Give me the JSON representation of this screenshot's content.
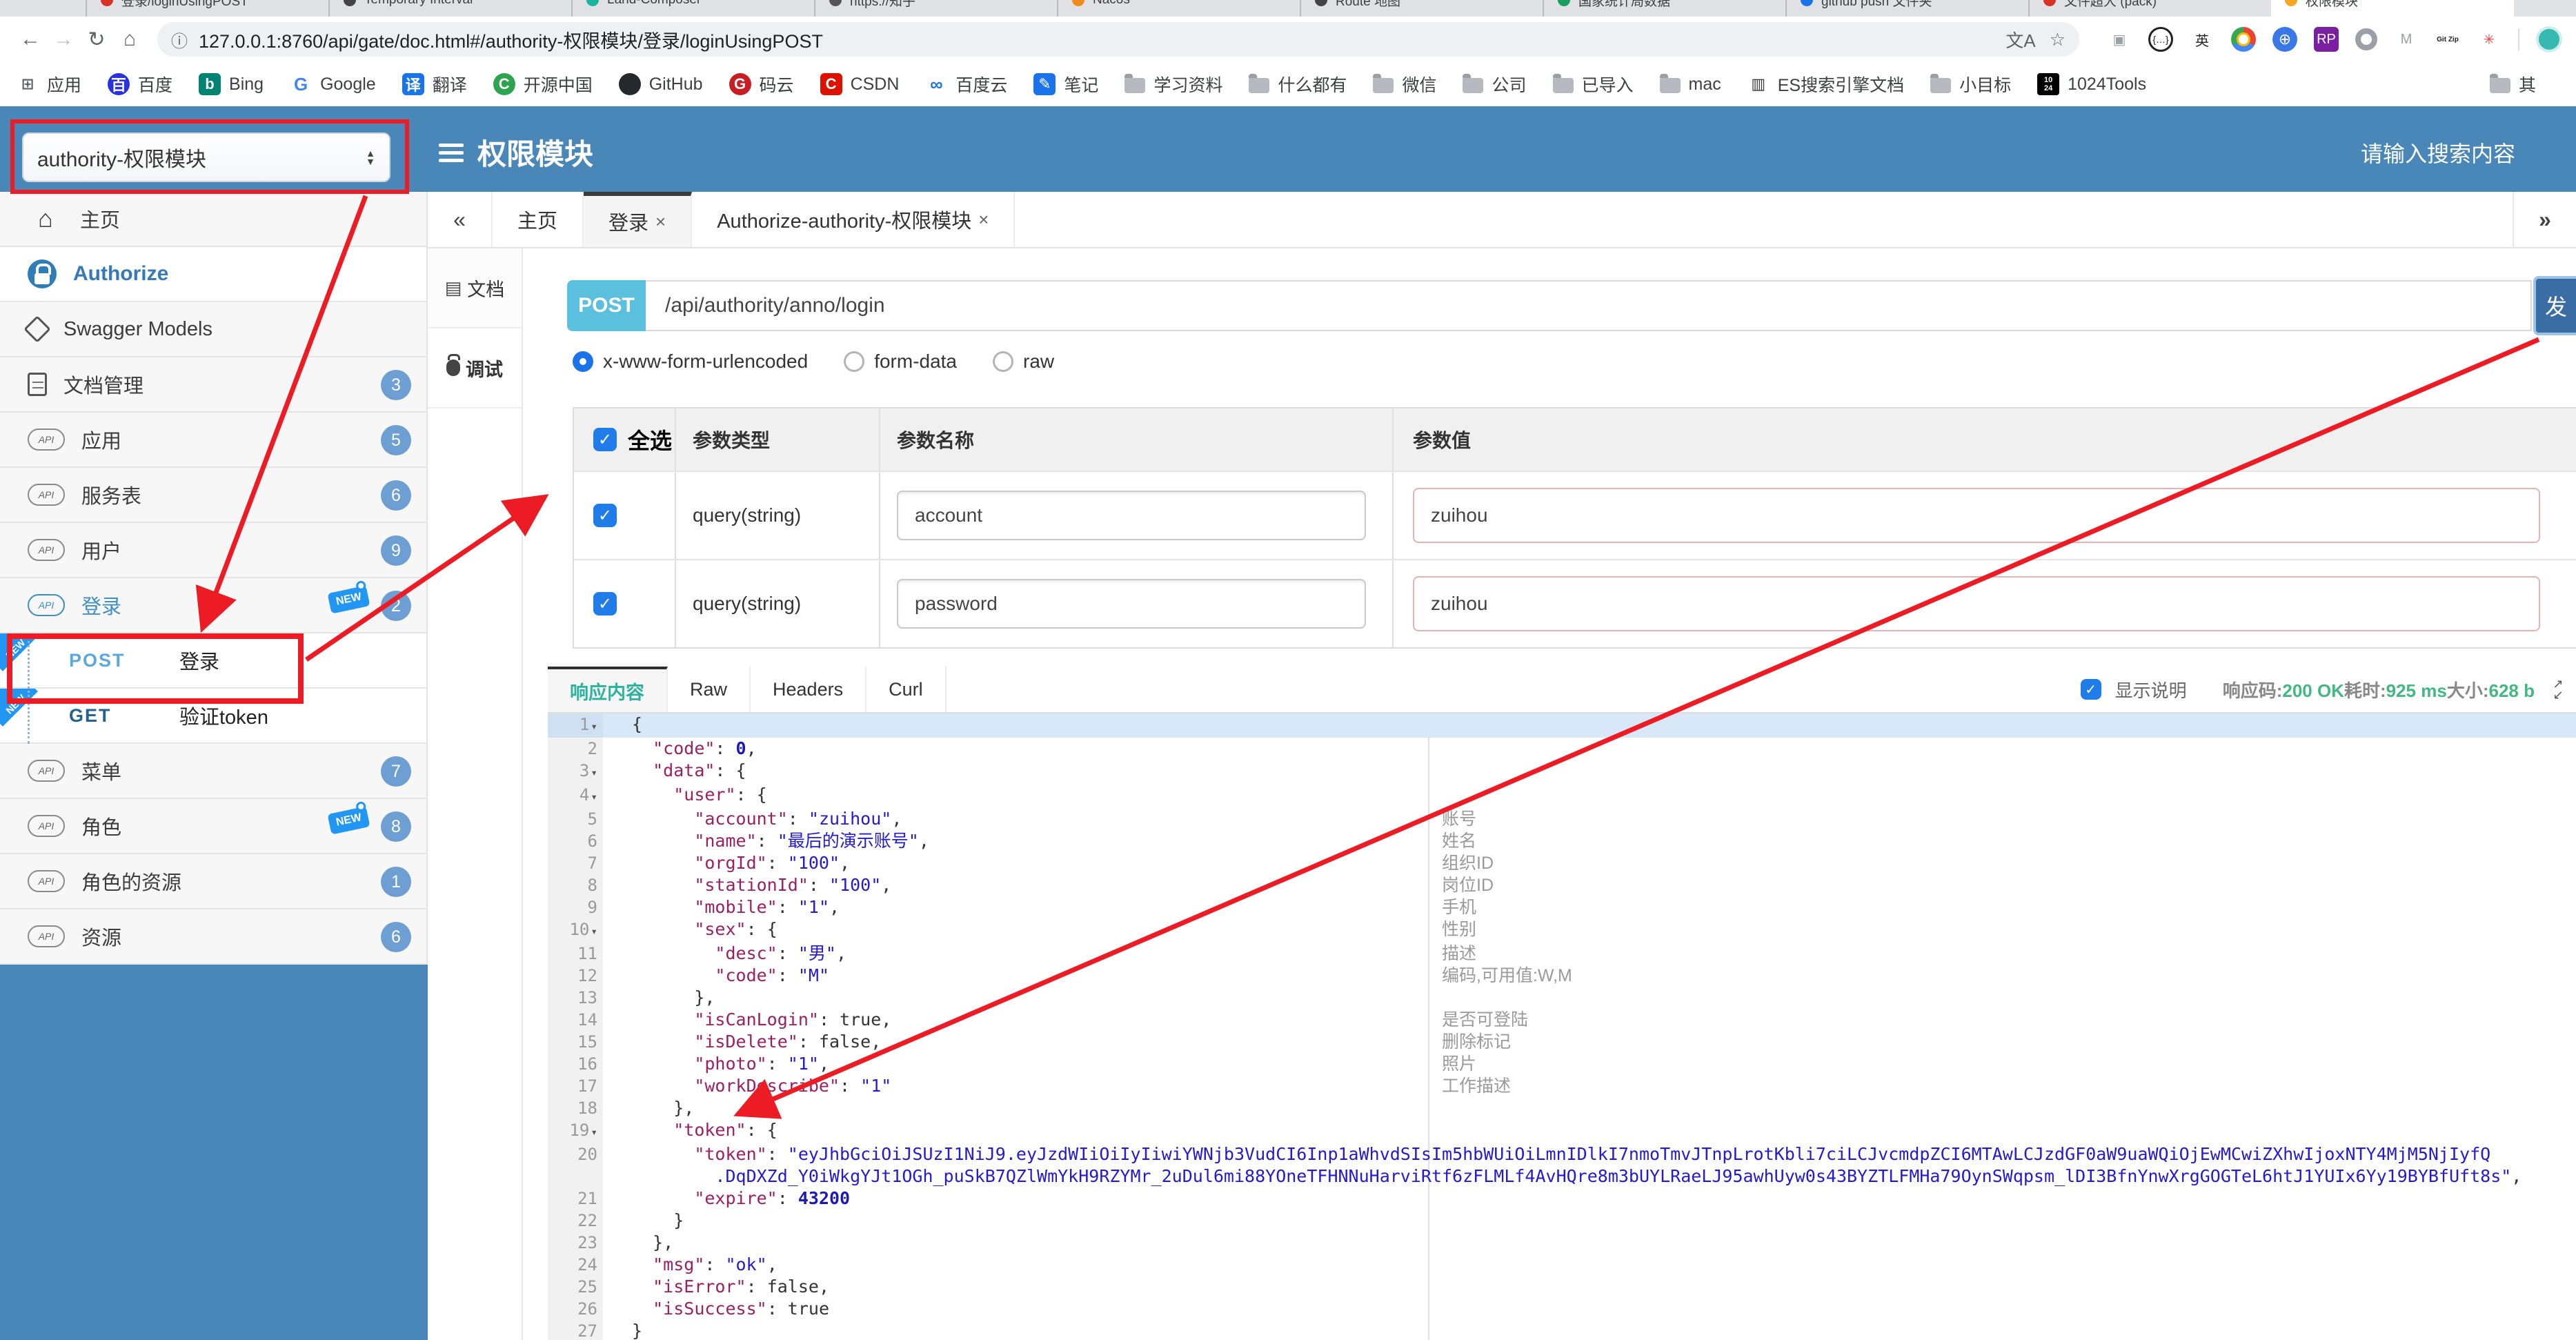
{
  "browser": {
    "tab_strip": [
      {
        "t": "登录/loginUsingPOST",
        "c": "#d93025"
      },
      {
        "t": "Temporary Interval",
        "c": "#444444"
      },
      {
        "t": "Land-Composer",
        "c": "#18b5a0"
      },
      {
        "t": "https://知乎",
        "c": "#555555"
      },
      {
        "t": "Nacos",
        "c": "#f08c1a"
      },
      {
        "t": "Route 地图",
        "c": "#444444"
      },
      {
        "t": "国家统计局数据",
        "c": "#17a05d"
      },
      {
        "t": "github push 文件夹",
        "c": "#1a73e8"
      },
      {
        "t": "文件超大 (pack)",
        "c": "#d93025"
      },
      {
        "t": "权限模块",
        "c": "#f5a623",
        "cls": "active"
      }
    ],
    "nav": {
      "back": "←",
      "forward": "→",
      "reload": "↻",
      "home": "⌂"
    },
    "url": {
      "info_icon": "ⓘ",
      "text": "127.0.0.1:8760/api/gate/doc.html#/authority-权限模块/登录/loginUsingPOST",
      "translate_icon": "文A",
      "star_icon": "☆"
    },
    "extensions": [
      {
        "g": "▣",
        "fg": "#9aa0a6"
      },
      {
        "g": "{…}",
        "fg": "#202124",
        "cls": "ring"
      },
      {
        "g": "英",
        "fg": "#202124"
      },
      {
        "g": "",
        "cls": "chrome"
      },
      {
        "g": "",
        "cls": "globe"
      },
      {
        "g": "RP",
        "bg": "#7b1fa2",
        "fg": "#ffffff"
      },
      {
        "g": "",
        "fg": "#9aa0a6",
        "cls": "ring2"
      },
      {
        "g": "M",
        "fg": "#9aa0a6"
      },
      {
        "g": "Git Zip",
        "fg": "#202124",
        "cls": "tiny"
      },
      {
        "g": "✳",
        "fg": "#e8453c"
      }
    ],
    "bookmarks": [
      {
        "label": "应用",
        "glyph": "⊞",
        "fg": "#5f6368"
      },
      {
        "label": "百度",
        "glyph": "百",
        "bg": "#2932e1",
        "fg": "#ffffff",
        "cls": "round"
      },
      {
        "label": "Bing",
        "glyph": "b",
        "bg": "#008373",
        "fg": "#ffffff"
      },
      {
        "label": "Google",
        "glyph": "G",
        "fg": "#4285f4",
        "cls": "bold"
      },
      {
        "label": "翻译",
        "glyph": "译",
        "bg": "#1a73e8",
        "fg": "#ffffff"
      },
      {
        "label": "开源中国",
        "glyph": "C",
        "bg": "#2ea44f",
        "fg": "#ffffff",
        "cls": "round"
      },
      {
        "label": "GitHub",
        "glyph": "",
        "bg": "#24292e",
        "fg": "#ffffff",
        "cls": "round"
      },
      {
        "label": "码云",
        "glyph": "G",
        "bg": "#c71d23",
        "fg": "#ffffff",
        "cls": "round"
      },
      {
        "label": "CSDN",
        "glyph": "C",
        "bg": "#dd1100",
        "fg": "#ffffff"
      },
      {
        "label": "百度云",
        "glyph": "∞",
        "fg": "#1a73e8",
        "cls": "bold"
      },
      {
        "label": "笔记",
        "glyph": "✎",
        "bg": "#1a73e8",
        "fg": "#ffffff"
      },
      {
        "label": "学习资料",
        "cls": "folder"
      },
      {
        "label": "什么都有",
        "cls": "folder"
      },
      {
        "label": "微信",
        "cls": "folder"
      },
      {
        "label": "公司",
        "cls": "folder"
      },
      {
        "label": "已导入",
        "cls": "folder"
      },
      {
        "label": "mac",
        "cls": "folder"
      },
      {
        "label": "ES搜索引擎文档",
        "glyph": "▥",
        "fg": "#333333"
      },
      {
        "label": "小目标",
        "cls": "folder"
      },
      {
        "label": "1024Tools",
        "glyph": "10\n24",
        "bg": "#000000",
        "fg": "#ffffff",
        "cls": "tiny"
      }
    ],
    "overflow_bookmark": "其"
  },
  "header": {
    "module_select_value": "authority-权限模块",
    "title": "权限模块",
    "search_placeholder": "请输入搜索内容",
    "accent": "#4a87b9"
  },
  "sidebar": {
    "items": [
      {
        "icls": "ic-home",
        "iglyph": "⌂",
        "label": "主页"
      },
      {
        "icls": "ic-lock",
        "label": "Authorize",
        "lcls": "lbl-auth",
        "cls": "white"
      },
      {
        "icls": "ic-hex",
        "label": "Swagger Models"
      },
      {
        "icls": "ic-page",
        "label": "文档管理",
        "badge": "3"
      },
      {
        "icls": "ic-api",
        "label": "应用",
        "badge": "5"
      },
      {
        "icls": "ic-api",
        "label": "服务表",
        "badge": "6"
      },
      {
        "icls": "ic-api",
        "label": "用户",
        "badge": "9"
      },
      {
        "icls": "ic-api blue",
        "label": "登录",
        "lcls": "lbl-blue",
        "badge": "2",
        "newsign": "NEW"
      },
      {
        "cls": "sub",
        "icls": "none",
        "m": "POST",
        "mcls": "m-post",
        "label": "登录",
        "ribbon": "NEW"
      },
      {
        "cls": "sub",
        "icls": "none",
        "m": "GET",
        "mcls": "m-get",
        "label": "验证token",
        "ribbon": "NEW"
      },
      {
        "icls": "ic-api",
        "label": "菜单",
        "badge": "7"
      },
      {
        "icls": "ic-api",
        "label": "角色",
        "badge": "8",
        "newsign": "NEW"
      },
      {
        "icls": "ic-api",
        "label": "角色的资源",
        "badge": "1"
      },
      {
        "icls": "ic-api",
        "label": "资源",
        "badge": "6"
      }
    ]
  },
  "content": {
    "collapse_icon": "«",
    "more_icon": "»",
    "tabs": [
      {
        "label": "主页"
      },
      {
        "label": "登录",
        "close": "×",
        "cls": "active"
      },
      {
        "label": "Authorize-authority-权限模块",
        "close": "×"
      }
    ],
    "subnav": [
      {
        "label": "文档",
        "icls": "ic-doc"
      },
      {
        "label": "调试",
        "icls": "ic-bug",
        "cls": "active"
      }
    ]
  },
  "request": {
    "method": "POST",
    "url": "/api/authority/anno/login",
    "send_label": "发",
    "body_types": [
      {
        "label": "x-www-form-urlencoded",
        "cls": "sel"
      },
      {
        "label": "form-data"
      },
      {
        "label": "raw"
      }
    ],
    "table": {
      "h_select": "全选",
      "h_type": "参数类型",
      "h_name": "参数名称",
      "h_value": "参数值",
      "rows": [
        {
          "type": "query(string)",
          "name": "account",
          "value": "zuihou"
        },
        {
          "type": "query(string)",
          "name": "password",
          "value": "zuihou"
        }
      ]
    }
  },
  "response": {
    "tabs": [
      {
        "label": "响应内容",
        "cls": "active"
      },
      {
        "label": "Raw"
      },
      {
        "label": "Headers"
      },
      {
        "label": "Curl"
      }
    ],
    "show_desc_label": "显示说明",
    "stats": [
      {
        "label": "响应码:",
        "value": "200 OK"
      },
      {
        "label": "耗时:",
        "value": "925 ms"
      },
      {
        "label": "大小:",
        "value": "628 b"
      }
    ]
  },
  "editor": {
    "lines": [
      {
        "n": "1",
        "caret": "▾",
        "cls": "hl",
        "pre": "{"
      },
      {
        "n": "2",
        "pre": "  ",
        "key": "\"code\"",
        "mid": ": ",
        "val": "0",
        "valcls": "tok-n",
        "post": ","
      },
      {
        "n": "3",
        "caret": "▾",
        "pre": "  ",
        "key": "\"data\"",
        "mid": ": ",
        "post": "{"
      },
      {
        "n": "4",
        "caret": "▾",
        "pre": "    ",
        "key": "\"user\"",
        "mid": ": ",
        "post": "{"
      },
      {
        "n": "5",
        "pre": "      ",
        "key": "\"account\"",
        "mid": ": ",
        "val": "\"zuihou\"",
        "valcls": "tok-s",
        "post": ",",
        "anno": "账号"
      },
      {
        "n": "6",
        "pre": "      ",
        "key": "\"name\"",
        "mid": ": ",
        "val": "\"最后的演示账号\"",
        "valcls": "tok-s",
        "post": ",",
        "anno": "姓名"
      },
      {
        "n": "7",
        "pre": "      ",
        "key": "\"orgId\"",
        "mid": ": ",
        "val": "\"100\"",
        "valcls": "tok-s",
        "post": ",",
        "anno": "组织ID"
      },
      {
        "n": "8",
        "pre": "      ",
        "key": "\"stationId\"",
        "mid": ": ",
        "val": "\"100\"",
        "valcls": "tok-s",
        "post": ",",
        "anno": "岗位ID"
      },
      {
        "n": "9",
        "pre": "      ",
        "key": "\"mobile\"",
        "mid": ": ",
        "val": "\"1\"",
        "valcls": "tok-s",
        "post": ",",
        "anno": "手机"
      },
      {
        "n": "10",
        "caret": "▾",
        "pre": "      ",
        "key": "\"sex\"",
        "mid": ": ",
        "post": "{",
        "anno": "性别"
      },
      {
        "n": "11",
        "pre": "        ",
        "key": "\"desc\"",
        "mid": ": ",
        "val": "\"男\"",
        "valcls": "tok-s",
        "post": ",",
        "anno": "描述"
      },
      {
        "n": "12",
        "pre": "        ",
        "key": "\"code\"",
        "mid": ": ",
        "val": "\"M\"",
        "valcls": "tok-s",
        "anno": "编码,可用值:W,M"
      },
      {
        "n": "13",
        "pre": "      },"
      },
      {
        "n": "14",
        "pre": "      ",
        "key": "\"isCanLogin\"",
        "mid": ": ",
        "val": "true",
        "valcls": "tok-b",
        "post": ",",
        "anno": "是否可登陆"
      },
      {
        "n": "15",
        "pre": "      ",
        "key": "\"isDelete\"",
        "mid": ": ",
        "val": "false",
        "valcls": "tok-b",
        "post": ",",
        "anno": "删除标记"
      },
      {
        "n": "16",
        "pre": "      ",
        "key": "\"photo\"",
        "mid": ": ",
        "val": "\"1\"",
        "valcls": "tok-s",
        "post": ",",
        "anno": "照片"
      },
      {
        "n": "17",
        "pre": "      ",
        "key": "\"workDescribe\"",
        "mid": ": ",
        "val": "\"1\"",
        "valcls": "tok-s",
        "anno": "工作描述"
      },
      {
        "n": "18",
        "pre": "    },"
      },
      {
        "n": "19",
        "caret": "▾",
        "pre": "    ",
        "key": "\"token\"",
        "mid": ": ",
        "post": "{"
      },
      {
        "n": "20",
        "pre": "      ",
        "key": "\"token\"",
        "mid": ": ",
        "val": "\"eyJhbGciOiJSUzI1NiJ9.eyJzdWIiOiIyIiwiYWNjb3VudCI6Inp1aWhvdSIsIm5hbWUiOiLmnIDlkI7nmoTmvJTnpLrotKbli7ciLCJvcmdpZCI6MTAwLCJzdGF0aW9uaWQiOjEwMCwiZXhwIjoxNTY4MjM5NjIyfQ\n        .DqDXZd_Y0iWkgYJt1OGh_puSkB7QZlWmYkH9RZYMr_2uDul6mi88YOneTFHNNuHarviRtf6zFLMLf4AvHQre8m3bUYLRaeLJ95awhUyw0s43BYZTLFMHa79OynSWqpsm_lDI3BfnYnwXrgGOGTeL6htJ1YUIx6Yy19BYBfUft8s\"",
        "valcls": "tok-s",
        "post": ","
      },
      {
        "n": "21",
        "pre": "      ",
        "key": "\"expire\"",
        "mid": ": ",
        "val": "43200",
        "valcls": "tok-n"
      },
      {
        "n": "22",
        "pre": "    }"
      },
      {
        "n": "23",
        "pre": "  },"
      },
      {
        "n": "24",
        "pre": "  ",
        "key": "\"msg\"",
        "mid": ": ",
        "val": "\"ok\"",
        "valcls": "tok-s",
        "post": ","
      },
      {
        "n": "25",
        "pre": "  ",
        "key": "\"isError\"",
        "mid": ": ",
        "val": "false",
        "valcls": "tok-b",
        "post": ","
      },
      {
        "n": "26",
        "pre": "  ",
        "key": "\"isSuccess\"",
        "mid": ": ",
        "val": "true",
        "valcls": "tok-b"
      },
      {
        "n": "27",
        "pre": "}"
      }
    ]
  }
}
